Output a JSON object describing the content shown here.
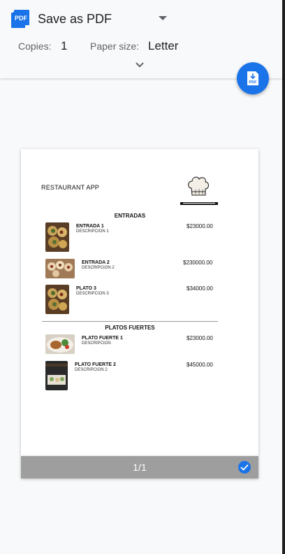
{
  "header": {
    "destination": "Save as PDF",
    "copies_label": "Copies:",
    "copies_value": "1",
    "paper_size_label": "Paper size:",
    "paper_size_value": "Letter",
    "fab_label": "PDF",
    "pdf_icon_label": "PDF"
  },
  "preview": {
    "app_name": "RESTAURANT APP",
    "sections": [
      {
        "title": "ENTRADAS"
      },
      {
        "title": "PLATOS FUERTES"
      }
    ],
    "items": [
      {
        "name": "ENTRADA 1",
        "description": "DESCRIPCION 1",
        "price": "$23000.00"
      },
      {
        "name": "ENTRADA 2",
        "description": "DESCRIPCION 2",
        "price": "$230000.00"
      },
      {
        "name": "PLATO 3",
        "description": "DESCRIPCION 3",
        "price": "$34000.00"
      },
      {
        "name": "PLATO FUERTE 1",
        "description": "DESCRIPCION",
        "price": "$23000.00"
      },
      {
        "name": "PLATO FUERTE 2",
        "description": "DESCRIPCION 2",
        "price": "$45000.00"
      }
    ],
    "page_indicator": "1/1"
  },
  "colors": {
    "accent": "#1a73e8",
    "footer": "#9e9e9e"
  }
}
